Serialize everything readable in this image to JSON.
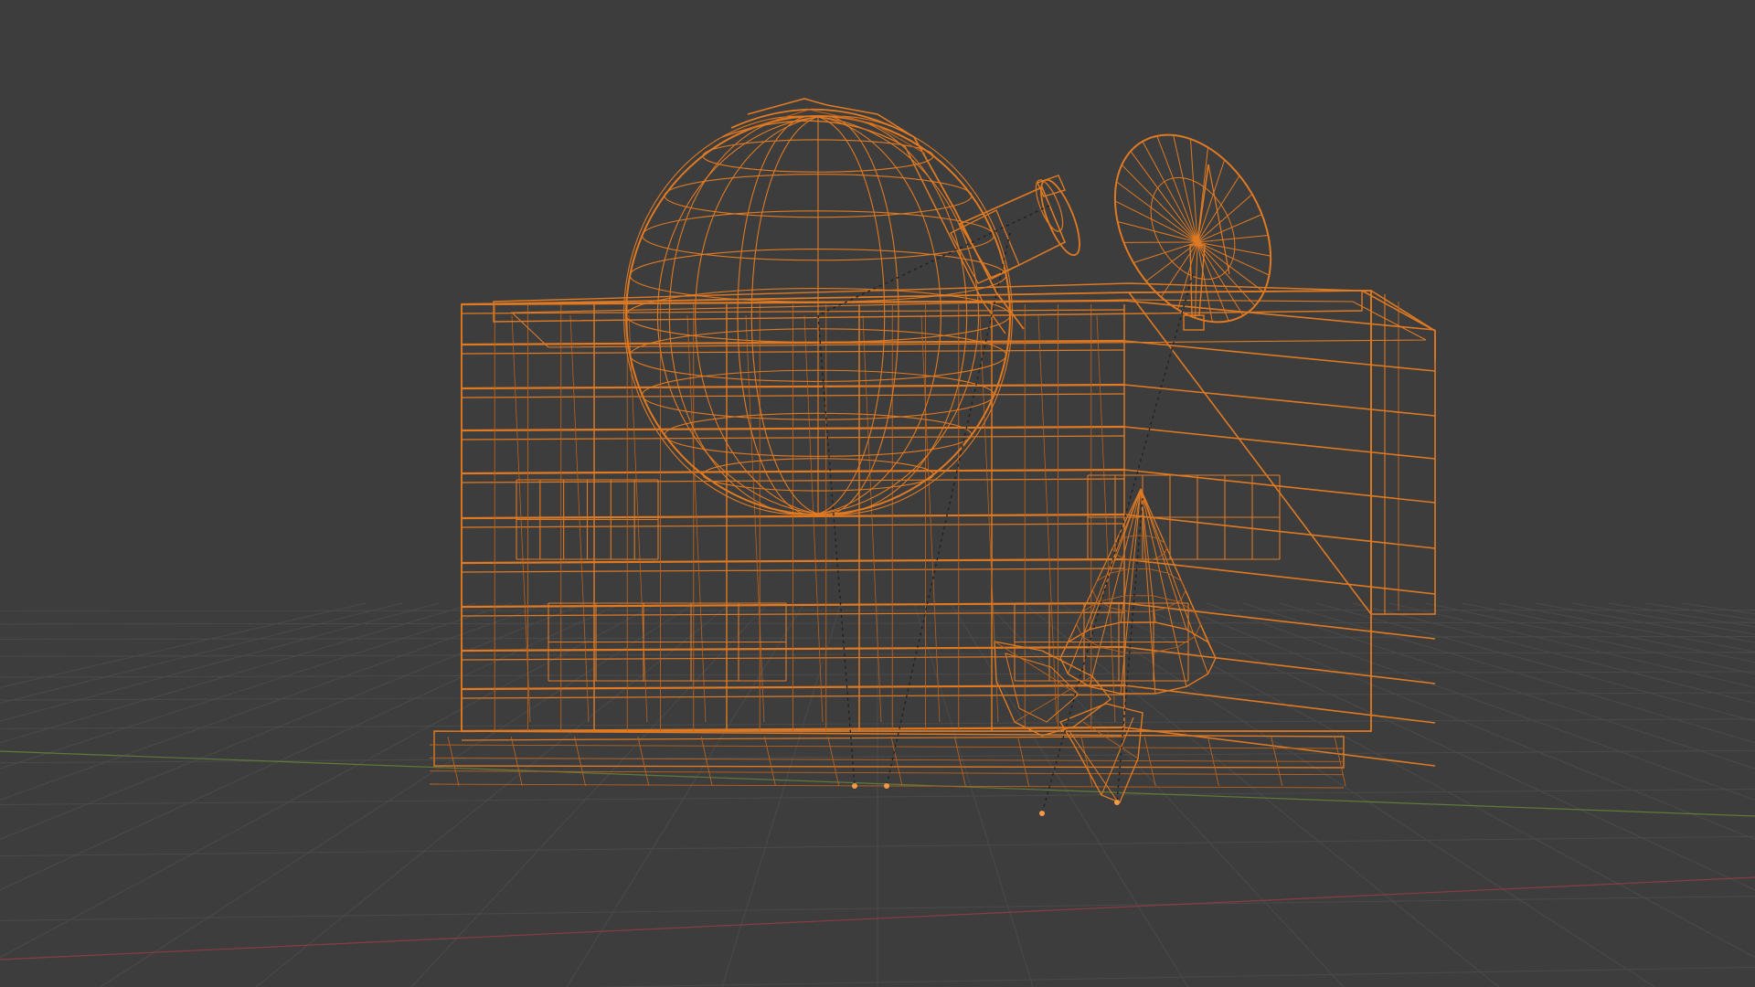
{
  "viewport": {
    "mode": "wireframe",
    "background_color": "#3d3d3d",
    "grid_color": "#4a4a4a",
    "x_axis_color": "#8a3c44",
    "y_axis_color": "#5f7a3a",
    "wire_color": "#e07a22",
    "wire_color_dim": "#b9621d",
    "relationship_line_color": "#1f1f1f"
  },
  "scene": {
    "objects": [
      {
        "name": "building",
        "icon": "box-wire"
      },
      {
        "name": "observatory-dome",
        "icon": "sphere-wire"
      },
      {
        "name": "dome-telescope",
        "icon": "cylinder-wire"
      },
      {
        "name": "satellite-dish",
        "icon": "dish-wire"
      },
      {
        "name": "tree-cone",
        "icon": "cone-wire"
      },
      {
        "name": "tree-rock",
        "icon": "rock-wire"
      },
      {
        "name": "ground-plane",
        "icon": "plane-wire"
      }
    ]
  }
}
